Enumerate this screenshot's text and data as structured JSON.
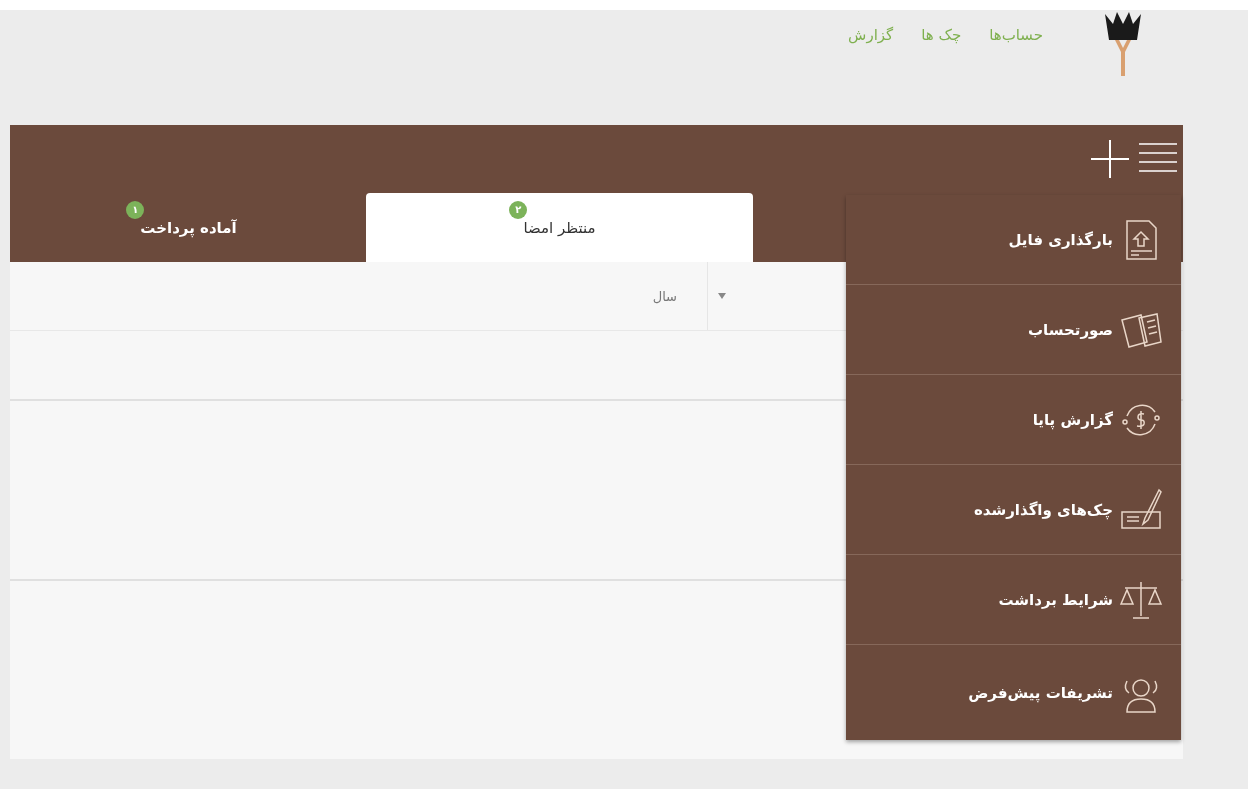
{
  "header": {
    "nav_links": [
      {
        "label": "حساب‌ها"
      },
      {
        "label": "چک ها"
      },
      {
        "label": "گزارش"
      }
    ]
  },
  "tabs": [
    {
      "label": "منتظر امضا",
      "badge": "۲",
      "selected": true
    },
    {
      "label": "آماده پرداخت",
      "badge": "۱",
      "selected": false
    }
  ],
  "filter": {
    "label": "سال"
  },
  "menu": {
    "items": [
      {
        "label": "بارگذاری فایل",
        "kind": "upload"
      },
      {
        "label": "صورتحساب",
        "kind": "statement"
      },
      {
        "label": "گزارش پایا",
        "kind": "transfer"
      },
      {
        "label": "چک‌های واگذارشده",
        "kind": "cheque"
      },
      {
        "label": "شرایط برداشت",
        "kind": "scale"
      },
      {
        "label": "تشریفات پیش‌فرض",
        "kind": "people"
      }
    ]
  }
}
